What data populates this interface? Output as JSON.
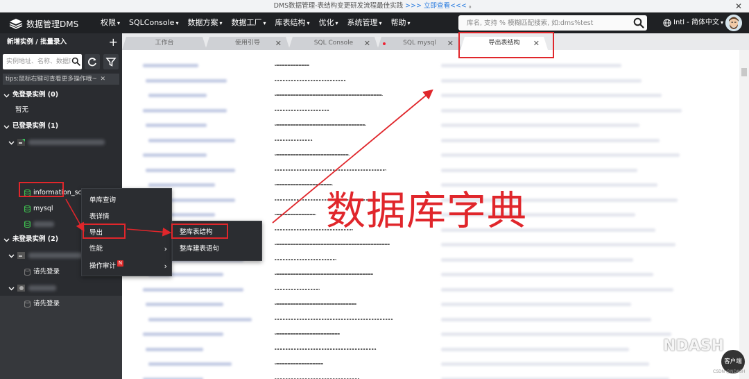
{
  "banner": {
    "text": "DMS数据管理-表结构变更研发流程最佳实践 ",
    "link": ">>> 立即查看<<<",
    "tail": " 。",
    "close": "✕"
  },
  "topbar": {
    "logo_text": "数据管理DMS",
    "menu": [
      {
        "label": "权限",
        "caret": "▾"
      },
      {
        "label": "SQLConsole",
        "caret": "▾"
      },
      {
        "label": "数据方案",
        "caret": "▾"
      },
      {
        "label": "数据工厂",
        "caret": "▾"
      },
      {
        "label": "库表结构",
        "caret": "▾"
      },
      {
        "label": "优化",
        "caret": "▾"
      },
      {
        "label": "系统管理",
        "caret": "▾"
      },
      {
        "label": "帮助",
        "caret": "▾"
      }
    ],
    "search_placeholder": "库名, 支持 % 模糊匹配搜索, 如:dms%test",
    "lang": "Intl - 简体中文",
    "lang_caret": "▾"
  },
  "sidebar": {
    "title": "新增实例 / 批量录入",
    "add": "+",
    "search_placeholder": "实例地址、名称、数据库",
    "tips": "tips:鼠标右键可查看更多操作哦~",
    "tips_close": "✕",
    "groups": [
      {
        "label": "免登录实例 (0)"
      },
      {
        "label": "暂无"
      },
      {
        "label": "已登录实例 (1)"
      },
      {
        "label": "information_schema"
      },
      {
        "label": "mysql"
      },
      {
        "label": "未登录实例 (2)"
      },
      {
        "label": "请先登录"
      },
      {
        "label": "请先登录"
      }
    ]
  },
  "tabs": [
    {
      "label": "工作台",
      "close": ""
    },
    {
      "label": "使用引导",
      "close": "✕"
    },
    {
      "label": "SQL Console",
      "close": "✕"
    },
    {
      "label": "SQL mysql",
      "close": "✕"
    },
    {
      "label": "导出表结构",
      "close": "✕"
    }
  ],
  "context_menu": {
    "items": [
      {
        "label": "单库查询",
        "arrow": ""
      },
      {
        "label": "表详情",
        "arrow": ""
      },
      {
        "label": "导出",
        "arrow": ""
      },
      {
        "label": "性能",
        "arrow": "›"
      },
      {
        "label": "操作审计",
        "arrow": "›",
        "badge": "N"
      }
    ],
    "submenu": [
      {
        "label": "整库表结构"
      },
      {
        "label": "整库建表语句"
      }
    ]
  },
  "annotation": "数据库字典",
  "watermark": "NDASH",
  "kefu": "客户端",
  "credit": "CSDN @NDASH",
  "colors": {
    "accent_red": "#e0262b",
    "topbar": "#1f2124",
    "sidebar": "#2a2c30",
    "link": "#2f7fe0"
  }
}
